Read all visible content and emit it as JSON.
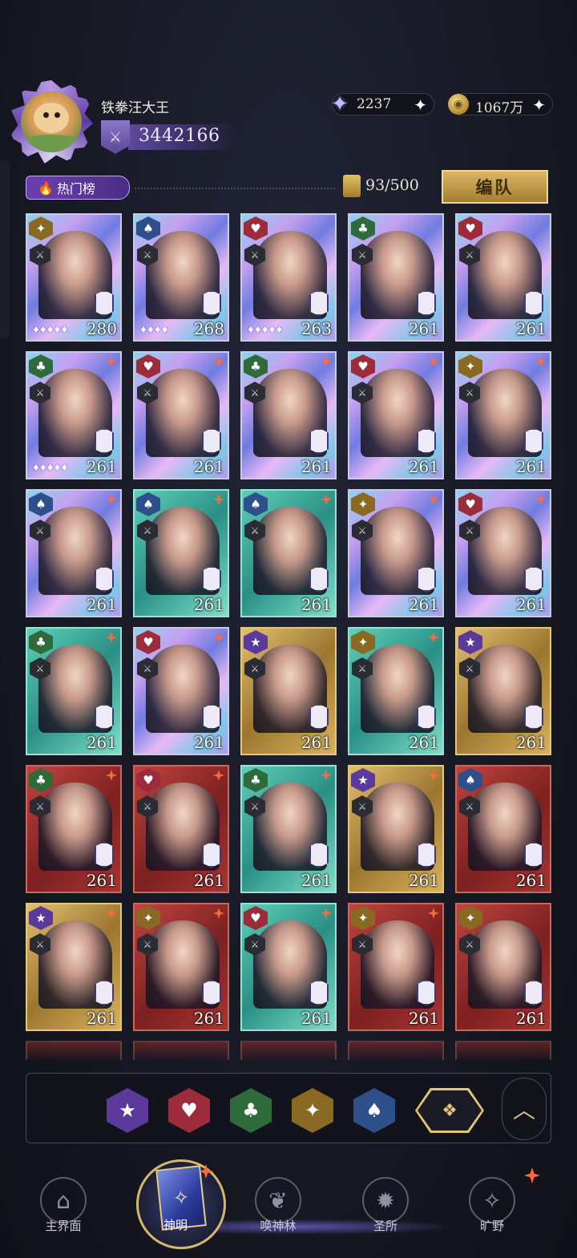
{
  "player": {
    "name": "铁拳汪大王",
    "power": "3442166",
    "avatar_icon": "hamster-avatar"
  },
  "currency": [
    {
      "icon": "star-gem-icon",
      "value": "2237"
    },
    {
      "icon": "gold-coin-icon",
      "value": "1067万"
    }
  ],
  "toolbar": {
    "hot_label": "热门榜",
    "count": "93/500",
    "team_label": "编队"
  },
  "cards": [
    {
      "suit": "diamond",
      "frame": "holo",
      "level": "280",
      "stars": "♦♦♦♦♦",
      "new": false
    },
    {
      "suit": "spade",
      "frame": "holo",
      "level": "268",
      "stars": "♦♦♦♦",
      "new": false
    },
    {
      "suit": "heart",
      "frame": "holo",
      "level": "263",
      "stars": "♦♦♦♦♦",
      "new": false
    },
    {
      "suit": "club",
      "frame": "holo",
      "level": "261",
      "stars": "",
      "new": false
    },
    {
      "suit": "heart",
      "frame": "holo",
      "level": "261",
      "stars": "",
      "new": false
    },
    {
      "suit": "club",
      "frame": "holo",
      "level": "261",
      "stars": "♦♦♦♦♦",
      "new": true
    },
    {
      "suit": "heart",
      "frame": "holo",
      "level": "261",
      "stars": "",
      "new": true
    },
    {
      "suit": "club",
      "frame": "holo",
      "level": "261",
      "stars": "",
      "new": true
    },
    {
      "suit": "heart",
      "frame": "holo",
      "level": "261",
      "stars": "",
      "new": true
    },
    {
      "suit": "diamond",
      "frame": "holo",
      "level": "261",
      "stars": "",
      "new": true
    },
    {
      "suit": "spade",
      "frame": "holo",
      "level": "261",
      "stars": "",
      "new": true
    },
    {
      "suit": "spade",
      "frame": "teal",
      "level": "261",
      "stars": "",
      "new": true
    },
    {
      "suit": "spade",
      "frame": "teal",
      "level": "261",
      "stars": "",
      "new": true
    },
    {
      "suit": "diamond",
      "frame": "holo",
      "level": "261",
      "stars": "",
      "new": true
    },
    {
      "suit": "heart",
      "frame": "holo",
      "level": "261",
      "stars": "",
      "new": true
    },
    {
      "suit": "club",
      "frame": "teal",
      "level": "261",
      "stars": "",
      "new": true
    },
    {
      "suit": "heart",
      "frame": "holo",
      "level": "261",
      "stars": "",
      "new": true
    },
    {
      "suit": "star",
      "frame": "gold",
      "level": "261",
      "stars": "",
      "new": false
    },
    {
      "suit": "diamond",
      "frame": "teal",
      "level": "261",
      "stars": "",
      "new": true
    },
    {
      "suit": "star",
      "frame": "gold",
      "level": "261",
      "stars": "",
      "new": false
    },
    {
      "suit": "club",
      "frame": "red",
      "level": "261",
      "stars": "",
      "new": true
    },
    {
      "suit": "heart",
      "frame": "red",
      "level": "261",
      "stars": "",
      "new": true
    },
    {
      "suit": "club",
      "frame": "teal",
      "level": "261",
      "stars": "",
      "new": true
    },
    {
      "suit": "star",
      "frame": "gold",
      "level": "261",
      "stars": "",
      "new": true
    },
    {
      "suit": "spade",
      "frame": "red",
      "level": "261",
      "stars": "",
      "new": false
    },
    {
      "suit": "star",
      "frame": "gold",
      "level": "261",
      "stars": "",
      "new": true
    },
    {
      "suit": "diamond",
      "frame": "red",
      "level": "261",
      "stars": "",
      "new": true
    },
    {
      "suit": "heart",
      "frame": "teal",
      "level": "261",
      "stars": "",
      "new": true
    },
    {
      "suit": "diamond",
      "frame": "red",
      "level": "261",
      "stars": "",
      "new": true
    },
    {
      "suit": "diamond",
      "frame": "red",
      "level": "261",
      "stars": "",
      "new": false
    }
  ],
  "filters": [
    "star",
    "heart",
    "club",
    "diamond",
    "spade",
    "all"
  ],
  "nav": {
    "main": "主界面",
    "gods": "神明",
    "summon": "唤神林",
    "sanctuary": "圣所",
    "wilds": "旷野"
  },
  "colors": {
    "accent_gold": "#e2c778",
    "notice_red": "#ff6a3a"
  }
}
